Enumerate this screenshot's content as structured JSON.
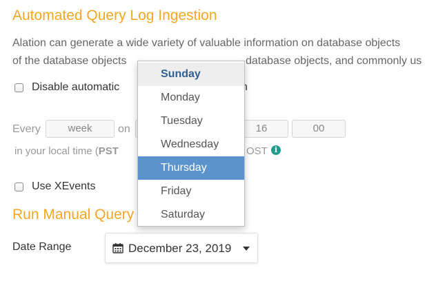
{
  "automated": {
    "title": "Automated Query Log Ingestion",
    "desc_line1": "Alation can generate a wide variety of valuable information on database objects",
    "desc_line2_a": "of the database objects",
    "desc_line2_b": "database objects, and commonly us",
    "disable_label_a": "Disable automatic",
    "disable_label_b": "n",
    "every_label": "Every",
    "period_value": "week",
    "on_label": "on",
    "hour_value": "16",
    "time_sep": ":",
    "minute_value": "00",
    "tz_prefix": "in your local time (",
    "tz_bold": "PST",
    "tz_suffix": "OST",
    "info_icon_glyph": "i"
  },
  "xevents": {
    "label": "Use XEvents"
  },
  "manual": {
    "title": "Run Manual Query",
    "date_range_label": "Date Range",
    "date_value": "December 23, 2019"
  },
  "day_dropdown": {
    "options": [
      "Sunday",
      "Monday",
      "Tuesday",
      "Wednesday",
      "Thursday",
      "Friday",
      "Saturday"
    ],
    "highlighted": "Sunday",
    "selected": "Thursday"
  },
  "colors": {
    "accent_orange": "#f5a623",
    "selected_blue": "#5b94cc",
    "info_teal": "#1e9c8e"
  },
  "icons": {
    "calendar": "calendar-icon",
    "caret": "caret-down-icon",
    "info": "info-icon"
  }
}
